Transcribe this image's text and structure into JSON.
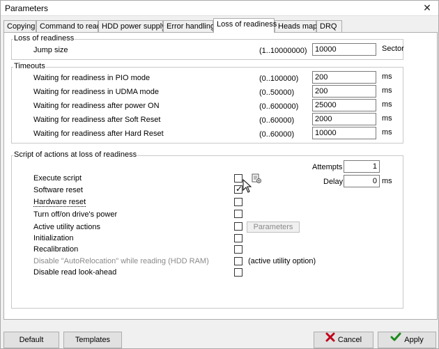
{
  "window": {
    "title": "Parameters",
    "close_glyph": "✕"
  },
  "tabs": [
    {
      "label": "Copying",
      "active": false
    },
    {
      "label": "Command to read",
      "active": false
    },
    {
      "label": "HDD power supply",
      "active": false
    },
    {
      "label": "Error handling",
      "active": false
    },
    {
      "label": "Loss of readiness",
      "active": true
    },
    {
      "label": "Heads map",
      "active": false
    },
    {
      "label": "DRQ",
      "active": false
    }
  ],
  "loss_of_readiness": {
    "title": "Loss of readiness",
    "jump_size": {
      "label": "Jump size",
      "range": "(1..10000000)",
      "value": "10000",
      "unit": "Sector"
    }
  },
  "timeouts": {
    "title": "Timeouts",
    "rows": [
      {
        "label": "Waiting for readiness in PIO mode",
        "range": "(0..100000)",
        "value": "200",
        "unit": "ms"
      },
      {
        "label": "Waiting for readiness in UDMA mode",
        "range": "(0..50000)",
        "value": "200",
        "unit": "ms"
      },
      {
        "label": "Waiting for readiness after power ON",
        "range": "(0..600000)",
        "value": "25000",
        "unit": "ms"
      },
      {
        "label": "Waiting for readiness after Soft Reset",
        "range": "(0..60000)",
        "value": "2000",
        "unit": "ms"
      },
      {
        "label": "Waiting for readiness after Hard Reset",
        "range": "(0..60000)",
        "value": "10000",
        "unit": "ms"
      }
    ]
  },
  "script": {
    "title": "Script of actions at loss of readiness",
    "attempts": {
      "label": "Attempts",
      "value": "1"
    },
    "delay": {
      "label": "Delay",
      "value": "0",
      "unit": "ms"
    },
    "items": [
      {
        "label": "Execute script",
        "checked": false,
        "disabled": false
      },
      {
        "label": "Software reset",
        "checked": true,
        "disabled": false
      },
      {
        "label": "Hardware reset",
        "checked": false,
        "disabled": false
      },
      {
        "label": "Turn off/on drive's power",
        "checked": false,
        "disabled": false
      },
      {
        "label": "Active utility actions",
        "checked": false,
        "disabled": false
      },
      {
        "label": "Initialization",
        "checked": false,
        "disabled": false
      },
      {
        "label": "Recalibration",
        "checked": false,
        "disabled": false
      },
      {
        "label": "Disable \"AutoRelocation\" while reading (HDD RAM)",
        "checked": false,
        "disabled": true
      },
      {
        "label": "Disable read look-ahead",
        "checked": false,
        "disabled": false
      }
    ],
    "parameters_button": "Parameters",
    "active_utility_option": "(active utility option)"
  },
  "footer": {
    "default_label": "Default",
    "templates_label": "Templates",
    "cancel_label": "Cancel",
    "apply_label": "Apply"
  },
  "colors": {
    "cancel_x": "#c0001a",
    "apply_check": "#1a8a1a"
  },
  "icons": {
    "script": "script-icon",
    "cancel": "red-x-icon",
    "apply": "green-check-icon",
    "cursor": "mouse-pointer-icon"
  }
}
